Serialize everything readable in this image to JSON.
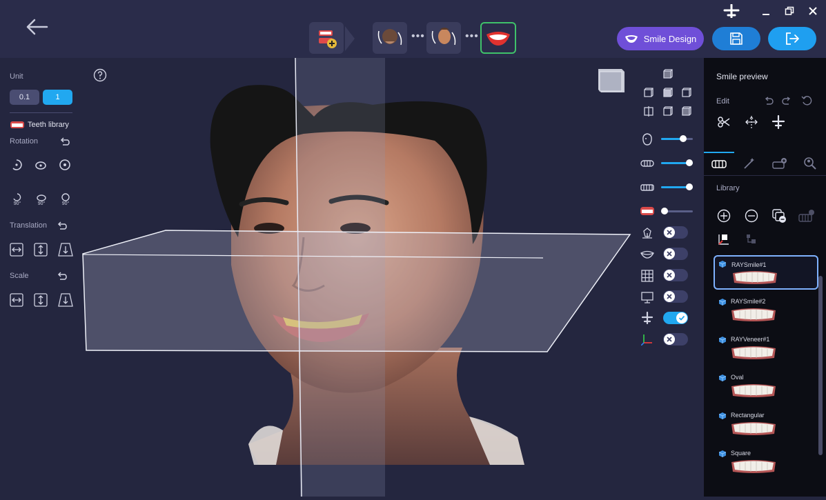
{
  "topbar": {
    "smile_design_label": "Smile Design"
  },
  "left_panel": {
    "unit_label": "Unit",
    "unit_options": [
      "0.1",
      "1"
    ],
    "teeth_library_label": "Teeth library",
    "rotation_label": "Rotation",
    "rotate_step_labels": [
      "90°",
      "90°",
      "90°"
    ],
    "translation_label": "Translation",
    "scale_label": "Scale"
  },
  "right_panel": {
    "smile_preview_label": "Smile preview",
    "edit_label": "Edit",
    "library_label": "Library",
    "library_items": [
      "RAYSmile#1",
      "RAYSmile#2",
      "RAYVeneer#1",
      "Oval",
      "Rectangular",
      "Square"
    ]
  },
  "view_controls": {
    "sliders": [
      {
        "icon": "face-opacity-icon",
        "value": 0.75
      },
      {
        "icon": "upper-teeth-icon",
        "value": 1.0
      },
      {
        "icon": "lower-teeth-icon",
        "value": 1.0
      },
      {
        "icon": "smile-teeth-icon",
        "value": 0.0
      }
    ],
    "toggles": [
      {
        "icon": "skeleton-icon",
        "on": false
      },
      {
        "icon": "lips-icon",
        "on": false
      },
      {
        "icon": "grid-icon",
        "on": false
      },
      {
        "icon": "monitor-icon",
        "on": false
      },
      {
        "icon": "plane-icon",
        "on": true
      },
      {
        "icon": "axes-icon",
        "on": false
      }
    ]
  },
  "colors": {
    "accent": "#21a8f0",
    "smile_button": "#6f4fd8",
    "active_step_border": "#3fc26a"
  }
}
